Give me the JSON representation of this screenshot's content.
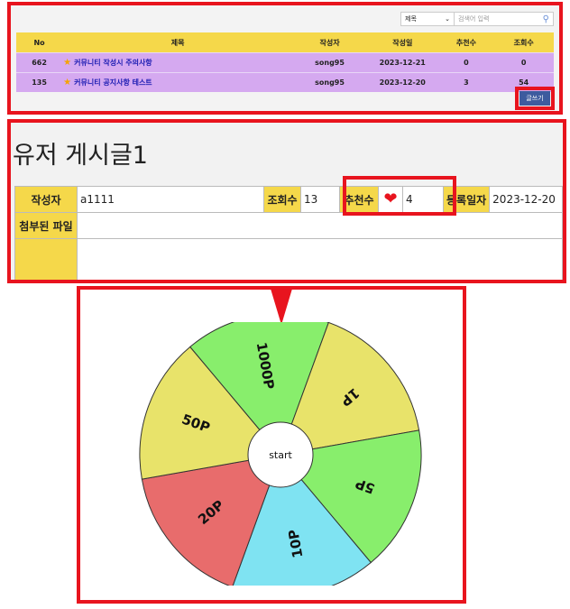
{
  "board": {
    "search": {
      "select_value": "제목",
      "placeholder": "검색어 입력"
    },
    "columns": [
      "No",
      "제목",
      "작성자",
      "작성일",
      "추천수",
      "조회수"
    ],
    "rows": [
      {
        "no": "662",
        "title": "커뮤니티 작성시 주의사항",
        "author": "song95",
        "date": "2023-12-21",
        "recommend": "0",
        "views": "0"
      },
      {
        "no": "135",
        "title": "커뮤니티 공지사항 테스트",
        "author": "song95",
        "date": "2023-12-20",
        "recommend": "3",
        "views": "54"
      }
    ],
    "write_label": "글쓰기"
  },
  "post": {
    "title": "유저 게시글1",
    "author_label": "작성자",
    "author": "a1111",
    "views_label": "조회수",
    "views": "13",
    "recommend_label": "추천수",
    "recommend": "4",
    "date_label": "등록일자",
    "date": "2023-12-20",
    "attach_label": "첨부된 파일"
  },
  "wheel": {
    "center_label": "start",
    "segments": [
      {
        "label": "1000P",
        "color": "#88ee6c"
      },
      {
        "label": "1P",
        "color": "#e8e36a"
      },
      {
        "label": "5P",
        "color": "#88ee6c"
      },
      {
        "label": "10P",
        "color": "#7fe3f2"
      },
      {
        "label": "20P",
        "color": "#e86c6c"
      },
      {
        "label": "50P",
        "color": "#e8e36a"
      }
    ]
  },
  "colors": {
    "highlight": "#e8141e",
    "header": "#f5d84a",
    "row": "#d5a9f0",
    "button": "#3d5b9e"
  }
}
